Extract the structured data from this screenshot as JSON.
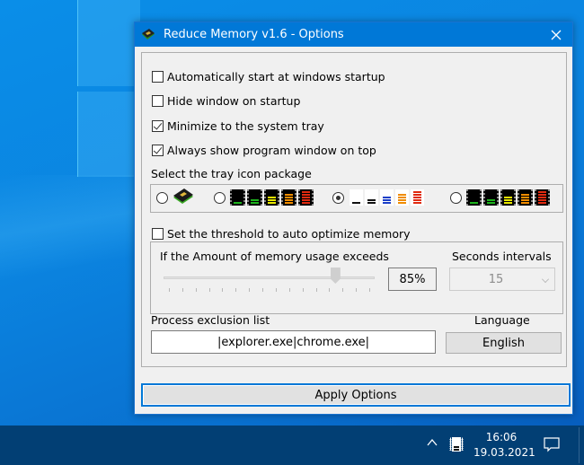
{
  "window": {
    "title": "Reduce Memory v1.6 - Options",
    "close_icon": "close-icon"
  },
  "options": [
    {
      "label": "Automatically start at windows startup",
      "checked": false
    },
    {
      "label": "Hide window on startup",
      "checked": false
    },
    {
      "label": "Minimize to the system tray",
      "checked": true
    },
    {
      "label": "Always show program window on top",
      "checked": true
    }
  ],
  "tray_icons": {
    "label": "Select the tray icon package",
    "packages": [
      {
        "name": "ram-stick",
        "selected": false
      },
      {
        "name": "dark-bars-dotted",
        "selected": false
      },
      {
        "name": "light-bars",
        "selected": true
      },
      {
        "name": "dark-bars",
        "selected": false
      }
    ],
    "level_colors": [
      "#1db31d",
      "#1db31d",
      "#e8e800",
      "#f08c00",
      "#e02a10"
    ],
    "light_colors": [
      "#111111",
      "#111111",
      "#1b3fc8",
      "#f08c00",
      "#e02a10"
    ]
  },
  "threshold": {
    "checkbox_label": "Set the threshold to auto optimize memory",
    "checked": false,
    "slider_label": "If the Amount of memory usage exceeds",
    "value_percent": 85,
    "value_text": "85%",
    "tick_count": 16,
    "interval_label": "Seconds intervals",
    "interval_value": "15"
  },
  "exclusion": {
    "label": "Process exclusion list",
    "value": "|explorer.exe|chrome.exe|"
  },
  "language": {
    "label": "Language",
    "value": "English"
  },
  "apply_label": "Apply Options",
  "taskbar": {
    "time": "16:06",
    "date": "19.03.2021"
  }
}
